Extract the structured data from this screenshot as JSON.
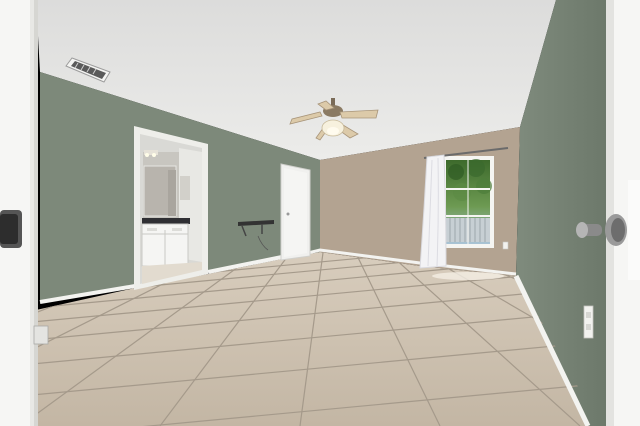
{
  "scene": {
    "palette": {
      "ceiling": "#e6e6e4",
      "green_wall": "#7f8a7c",
      "green_wall_dark": "#6f7a6d",
      "tan_wall": "#b5a593",
      "floor": "#cbbfae",
      "grout": "#9e9384",
      "baseboard": "#f2f2ef",
      "door_white": "#f4f4f2",
      "window_glass": "#4f7a3b",
      "curtain": "#f0f0f2",
      "fan_blade": "#d9c7a8"
    },
    "objects": [
      "ceiling-vent",
      "ceiling-fan",
      "bathroom-doorway",
      "vanity-cabinet",
      "wall-shelf",
      "closet-door",
      "window",
      "curtain",
      "tile-floor",
      "left-door",
      "right-door",
      "door-knob",
      "outlet"
    ]
  }
}
